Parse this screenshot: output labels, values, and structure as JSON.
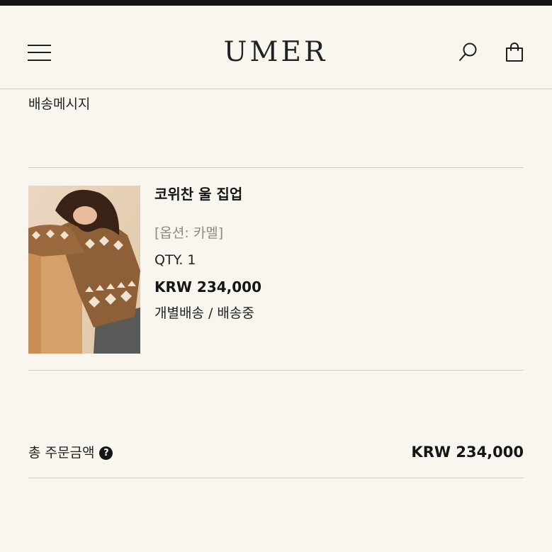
{
  "header": {
    "logo": "UMER",
    "menu_icon": "hamburger-menu-icon",
    "search_icon": "search-icon",
    "cart_icon": "shopping-bag-icon"
  },
  "order": {
    "delivery_message_label": "배송메시지",
    "items": [
      {
        "name": "코위찬 울 집업",
        "option": "[옵션: 카멜]",
        "qty": "QTY. 1",
        "price": "KRW 234,000",
        "status": "개별배송 / 배송중"
      }
    ],
    "total": {
      "label": "총 주문금액",
      "help_icon": "?",
      "value": "KRW 234,000"
    }
  },
  "colors": {
    "background": "#f9f5ef",
    "topbar": "#151515",
    "divider": "#cfcac3",
    "text": "#1c1c1c",
    "muted": "#8f8a85"
  }
}
